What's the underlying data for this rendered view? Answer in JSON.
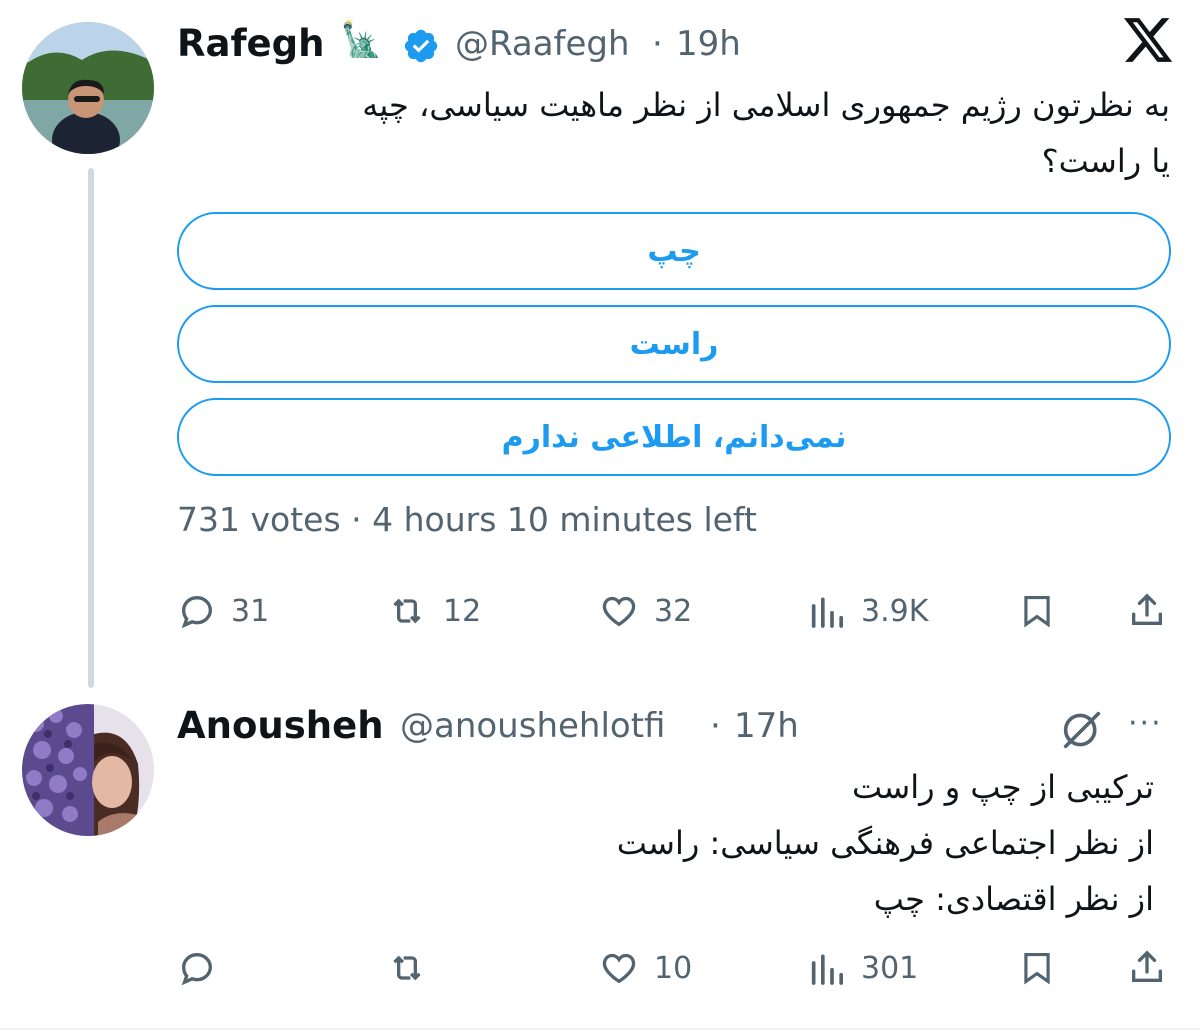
{
  "tweet": {
    "display_name": "Rafegh",
    "name_emoji": "🗽",
    "handle": "@Raafegh",
    "separator": "·",
    "time": "19h",
    "text_line1": "به نظرتون رژیم جمهوری اسلامی از نظر ماهیت سیاسی، چپه",
    "text_line2": "یا راست؟",
    "poll": {
      "options": [
        "چپ",
        "راست",
        "نمی‌دانم، اطلاعی ندارم"
      ],
      "votes": "731 votes",
      "separator": "·",
      "time_left": "4 hours 10 minutes left"
    },
    "actions": {
      "replies": "31",
      "reposts": "12",
      "likes": "32",
      "views": "3.9K"
    },
    "icons": [
      "x-logo-icon",
      "verified-badge-icon",
      "reply-icon",
      "repost-icon",
      "like-icon",
      "views-icon",
      "bookmark-icon",
      "share-icon"
    ]
  },
  "reply": {
    "display_name": "Anousheh",
    "handle": "@anoushehlotfi",
    "separator": "·",
    "time": "17h",
    "more": "···",
    "line1": "ترکیبی از چپ و راست",
    "line2": "از نظر اجتماعی فرهنگی سیاسی: راست",
    "line3": "از نظر اقتصادی: چپ",
    "actions": {
      "replies": "",
      "reposts": "",
      "likes": "10",
      "views": "301"
    },
    "icons": [
      "grok-icon",
      "more-icon"
    ]
  },
  "colors": {
    "accent": "#1d9bf0",
    "text": "#0f1419",
    "secondary": "#536471",
    "thread_line": "#cfd9de"
  }
}
